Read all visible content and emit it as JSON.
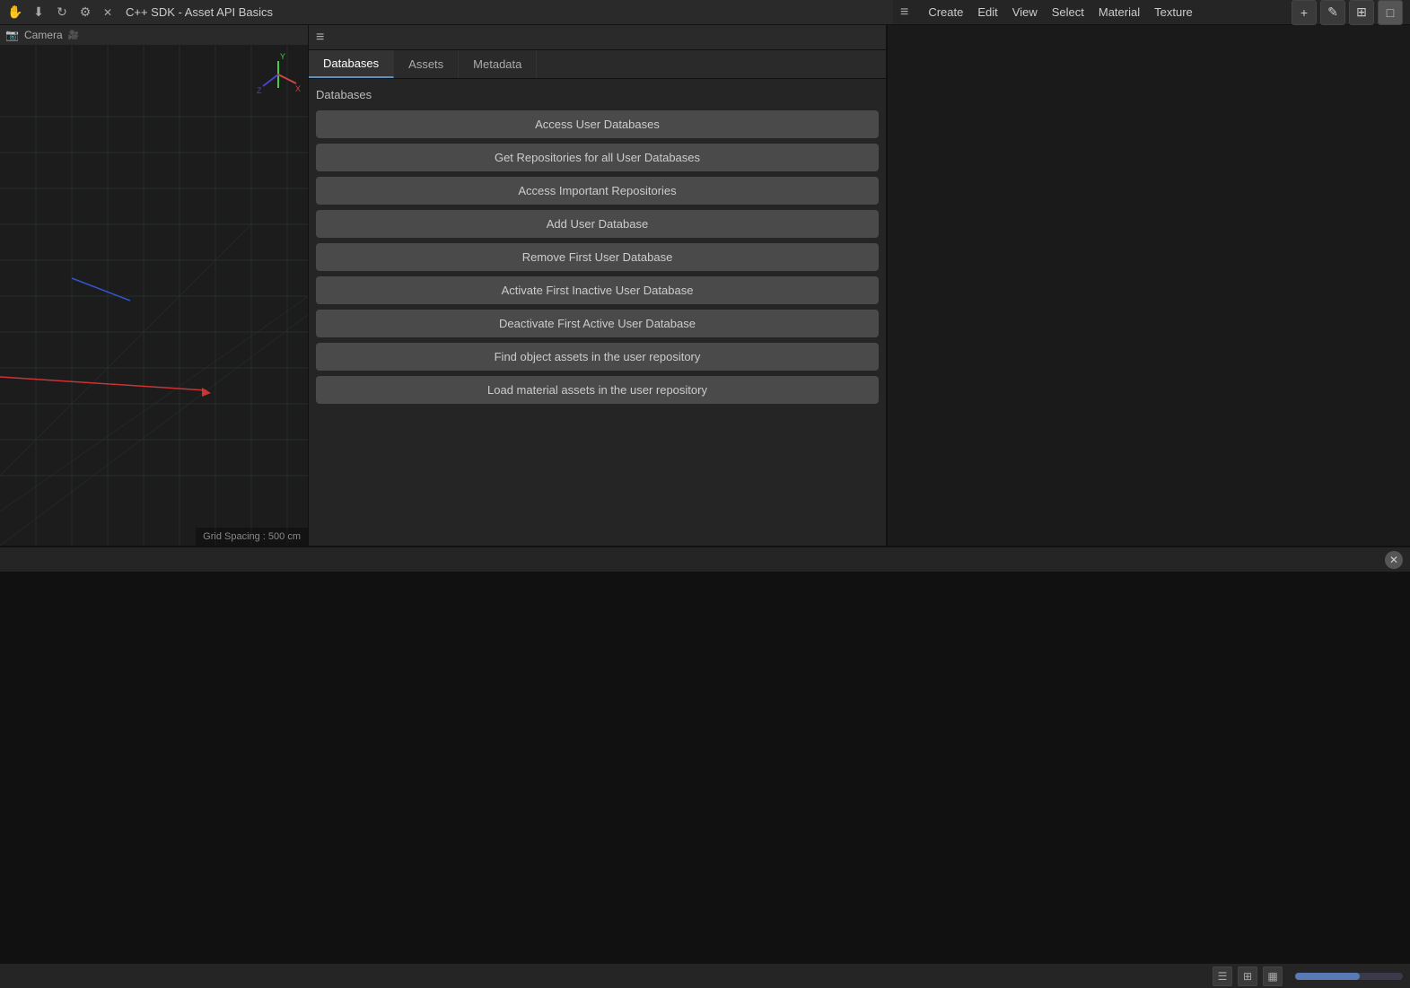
{
  "titlebar": {
    "title": "C++ SDK - Asset API Basics",
    "icons": [
      "hand-icon",
      "download-icon",
      "refresh-icon",
      "settings-icon"
    ]
  },
  "top_menu_right": {
    "items": [
      "Create",
      "Edit",
      "View",
      "Select",
      "Material",
      "Texture"
    ]
  },
  "hamburger": "☰",
  "tabs": {
    "items": [
      "Databases",
      "Assets",
      "Metadata"
    ],
    "active": "Databases"
  },
  "section": {
    "label": "Databases"
  },
  "buttons": [
    {
      "label": "Access User Databases"
    },
    {
      "label": "Get Repositories for all User Databases"
    },
    {
      "label": "Access Important Repositories"
    },
    {
      "label": "Add User Database"
    },
    {
      "label": "Remove First User Database"
    },
    {
      "label": "Activate First Inactive User Database"
    },
    {
      "label": "Deactivate First Active User Database"
    },
    {
      "label": "Find object assets in the user repository"
    },
    {
      "label": "Load material assets in the user repository"
    }
  ],
  "viewport": {
    "camera_label": "Camera",
    "grid_spacing": "Grid Spacing : 500 cm"
  },
  "toolbar": {
    "add_label": "+",
    "btn2": "✎",
    "btn3": "⊞"
  },
  "close_icon": "✕",
  "footer_icons": [
    "list-icon",
    "grid-icon",
    "detail-icon"
  ]
}
